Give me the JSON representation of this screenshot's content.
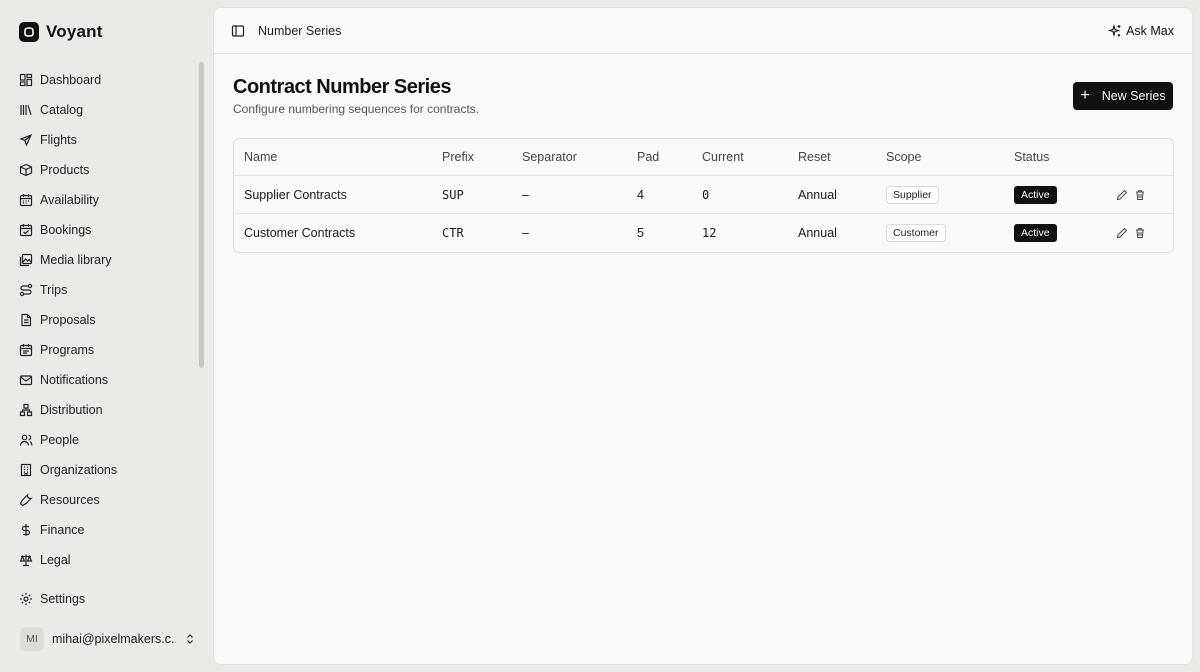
{
  "app": {
    "name": "Voyant"
  },
  "sidebar": {
    "items": [
      {
        "label": "Dashboard",
        "icon": "dashboard-icon"
      },
      {
        "label": "Catalog",
        "icon": "library-icon"
      },
      {
        "label": "Flights",
        "icon": "plane-icon"
      },
      {
        "label": "Products",
        "icon": "package-icon"
      },
      {
        "label": "Availability",
        "icon": "calendar-icon"
      },
      {
        "label": "Bookings",
        "icon": "calendar-check-icon"
      },
      {
        "label": "Media library",
        "icon": "images-icon"
      },
      {
        "label": "Trips",
        "icon": "route-icon"
      },
      {
        "label": "Proposals",
        "icon": "file-text-icon"
      },
      {
        "label": "Programs",
        "icon": "calendar-range-icon"
      },
      {
        "label": "Notifications",
        "icon": "mail-icon"
      },
      {
        "label": "Distribution",
        "icon": "network-icon"
      },
      {
        "label": "People",
        "icon": "users-icon"
      },
      {
        "label": "Organizations",
        "icon": "building-icon"
      },
      {
        "label": "Resources",
        "icon": "wrench-icon"
      },
      {
        "label": "Finance",
        "icon": "dollar-icon"
      },
      {
        "label": "Legal",
        "icon": "scale-icon"
      }
    ],
    "settings_label": "Settings",
    "user": {
      "initials": "MI",
      "email": "mihai@pixelmakers.c..."
    }
  },
  "header": {
    "breadcrumb": "Number Series",
    "ask_label": "Ask Max"
  },
  "page": {
    "title": "Contract Number Series",
    "subtitle": "Configure numbering sequences for contracts.",
    "new_button_label": "New Series"
  },
  "table": {
    "columns": [
      "Name",
      "Prefix",
      "Separator",
      "Pad",
      "Current",
      "Reset",
      "Scope",
      "Status"
    ],
    "rows": [
      {
        "name": "Supplier Contracts",
        "prefix": "SUP",
        "separator": "–",
        "pad": "4",
        "current": "0",
        "reset": "Annual",
        "scope": "Supplier",
        "status": "Active"
      },
      {
        "name": "Customer Contracts",
        "prefix": "CTR",
        "separator": "–",
        "pad": "5",
        "current": "12",
        "reset": "Annual",
        "scope": "Customer",
        "status": "Active"
      }
    ]
  },
  "colors": {
    "accent": "#111111",
    "background": "#ebeae7",
    "panel": "#fafafa"
  }
}
